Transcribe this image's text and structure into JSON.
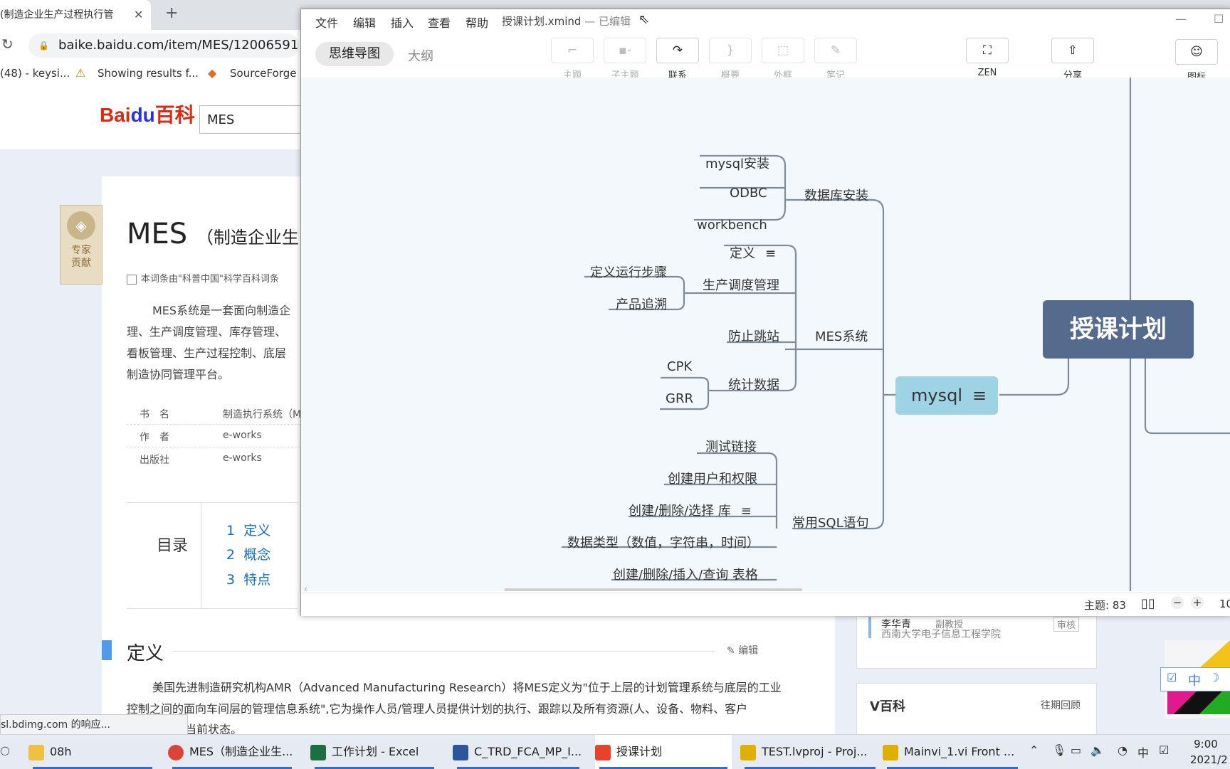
{
  "browser": {
    "tab_title": "(制造企业生产过程执行管",
    "tab_close": "✕",
    "new_tab": "+",
    "url": "baike.baidu.com/item/MES/12006591",
    "bookmarks": [
      "(48) - keysi...",
      "Showing results f...",
      "SourceForge -"
    ],
    "search_value": "MES",
    "logo": {
      "bai": "Bai",
      "du": "du",
      "baike": "百科"
    },
    "status_url": "sl.bdimg.com 的响应..."
  },
  "baike": {
    "expert_badge": "专家贡献",
    "title": "MES",
    "subtitle": "（制造企业生",
    "source_note": "本词条由\"科普中国\"科学百科词条",
    "summary": [
      "MES系统是一套面向制造企",
      "理、生产调度管理、库存管理、",
      "看板管理、生产过程控制、底层",
      "制造协同管理平台。"
    ],
    "info": [
      {
        "k": "书　名",
        "v": "制造执行系统（M"
      },
      {
        "k": "作　者",
        "v": "e-works"
      },
      {
        "k": "出版社",
        "v": "e-works"
      }
    ],
    "toc_title": "目录",
    "toc": [
      {
        "num": "1",
        "label": "定义"
      },
      {
        "num": "2",
        "label": "概念"
      },
      {
        "num": "3",
        "label": "特点"
      }
    ],
    "section_title": "定义",
    "edit_label": "编辑",
    "def_text": [
      "美国先进制造研究机构AMR（Advanced Manufacturing Research）将MES定义为\"位于上层的计划管理系统与底层的工业",
      "控制之间的面向车间层的管理信息系统\",它为操作人员/管理人员提供计划的执行、跟踪以及所有资源(人、设备、物料、客户",
      "当前状态。"
    ],
    "reviewer_name": "李华青",
    "reviewer_title": "副教授",
    "reviewer_org": "西南大学电子信息工程学院",
    "review_badge": "审核",
    "vbaike": "V百科",
    "past": "往期回顾"
  },
  "xmind": {
    "menus": [
      "文件",
      "编辑",
      "插入",
      "查看",
      "帮助"
    ],
    "window_title": "授课计划.xmind",
    "window_status": "— 已编辑",
    "view_tabs": [
      "思维导图",
      "大纲"
    ],
    "tools": [
      {
        "icon": "⌐",
        "label": "主题"
      },
      {
        "icon": "▪-",
        "label": "子主题"
      },
      {
        "icon": "↷",
        "label": "联系"
      },
      {
        "icon": "}",
        "label": "概要"
      },
      {
        "icon": "⬚",
        "label": "外框"
      },
      {
        "icon": "✎",
        "label": "笔记"
      }
    ],
    "zen": {
      "icon": "⛶",
      "label": "ZEN"
    },
    "share": {
      "icon": "⇧",
      "label": "分享"
    },
    "emoji": {
      "icon": "☺",
      "label": "图标"
    },
    "central_topic": "授课计划",
    "main_topic": "mysql",
    "topics": {
      "db_install": "数据库安装",
      "mysql_install": "mysql安装",
      "odbc": "ODBC",
      "workbench": "workbench",
      "mes": "MES系统",
      "def": "定义",
      "sched": "生产调度管理",
      "steps": "定义运行步骤",
      "trace": "产品追溯",
      "antiskip": "防止跳站",
      "stats": "统计数据",
      "cpk": "CPK",
      "grr": "GRR",
      "sql": "常用SQL语句",
      "test_link": "测试链接",
      "create_user": "创建用户和权限",
      "db_ops": "创建/删除/选择  库",
      "types": "数据类型（数值，字符串，时间）",
      "table_ops": "创建/删除/插入/查询 表格"
    },
    "status_topics": "主题: 83",
    "zoom": "10"
  },
  "taskbar": [
    {
      "label": "08h",
      "color": "#f0c040"
    },
    {
      "label": "MES（制造企业生...",
      "color": "#db4437"
    },
    {
      "label": "工作计划 - Excel",
      "color": "#1d6f42"
    },
    {
      "label": "C_TRD_FCA_MP_I...",
      "color": "#2b579a"
    },
    {
      "label": "授课计划",
      "color": "#e8412c"
    },
    {
      "label": "TEST.lvproj - Proj...",
      "color": "#e0b000"
    },
    {
      "label": "Mainvi_1.vi Front ...",
      "color": "#e0b000"
    }
  ],
  "tray": {
    "ime": "中",
    "time": "9:00",
    "date": "2021/2"
  }
}
